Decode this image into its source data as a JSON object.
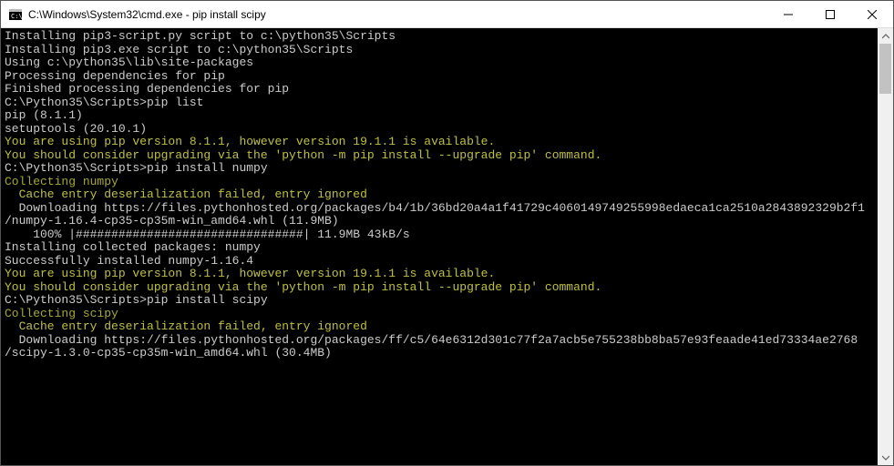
{
  "window": {
    "title": "C:\\Windows\\System32\\cmd.exe - pip  install scipy"
  },
  "lines": [
    {
      "cls": "",
      "text": "Installing pip3-script.py script to c:\\python35\\Scripts"
    },
    {
      "cls": "",
      "text": "Installing pip3.exe script to c:\\python35\\Scripts"
    },
    {
      "cls": "",
      "text": ""
    },
    {
      "cls": "",
      "text": "Using c:\\python35\\lib\\site-packages"
    },
    {
      "cls": "",
      "text": "Processing dependencies for pip"
    },
    {
      "cls": "",
      "text": "Finished processing dependencies for pip"
    },
    {
      "cls": "",
      "text": ""
    },
    {
      "cls": "",
      "text": "C:\\Python35\\Scripts>pip list"
    },
    {
      "cls": "",
      "text": "pip (8.1.1)"
    },
    {
      "cls": "",
      "text": "setuptools (20.10.1)"
    },
    {
      "cls": "warn",
      "text": "You are using pip version 8.1.1, however version 19.1.1 is available."
    },
    {
      "cls": "warn",
      "text": "You should consider upgrading via the 'python -m pip install --upgrade pip' command."
    },
    {
      "cls": "",
      "text": ""
    },
    {
      "cls": "",
      "text": "C:\\Python35\\Scripts>pip install numpy"
    },
    {
      "cls": "collecting",
      "text": "Collecting numpy"
    },
    {
      "cls": "warn",
      "text": "  Cache entry deserialization failed, entry ignored"
    },
    {
      "cls": "",
      "text": "  Downloading https://files.pythonhosted.org/packages/b4/1b/36bd20a4a1f41729c4060149749255998edaeca1ca2510a2843892329b2f1"
    },
    {
      "cls": "",
      "text": "/numpy-1.16.4-cp35-cp35m-win_amd64.whl (11.9MB)"
    },
    {
      "cls": "",
      "text": "    100% |################################| 11.9MB 43kB/s"
    },
    {
      "cls": "",
      "text": "Installing collected packages: numpy"
    },
    {
      "cls": "",
      "text": "Successfully installed numpy-1.16.4"
    },
    {
      "cls": "warn",
      "text": "You are using pip version 8.1.1, however version 19.1.1 is available."
    },
    {
      "cls": "warn",
      "text": "You should consider upgrading via the 'python -m pip install --upgrade pip' command."
    },
    {
      "cls": "",
      "text": ""
    },
    {
      "cls": "",
      "text": "C:\\Python35\\Scripts>pip install scipy"
    },
    {
      "cls": "collecting",
      "text": "Collecting scipy"
    },
    {
      "cls": "warn",
      "text": "  Cache entry deserialization failed, entry ignored"
    },
    {
      "cls": "",
      "text": "  Downloading https://files.pythonhosted.org/packages/ff/c5/64e6312d301c77f2a7acb5e755238bb8ba57e93feaade41ed73334ae2768"
    },
    {
      "cls": "",
      "text": "/scipy-1.3.0-cp35-cp35m-win_amd64.whl (30.4MB)"
    }
  ]
}
